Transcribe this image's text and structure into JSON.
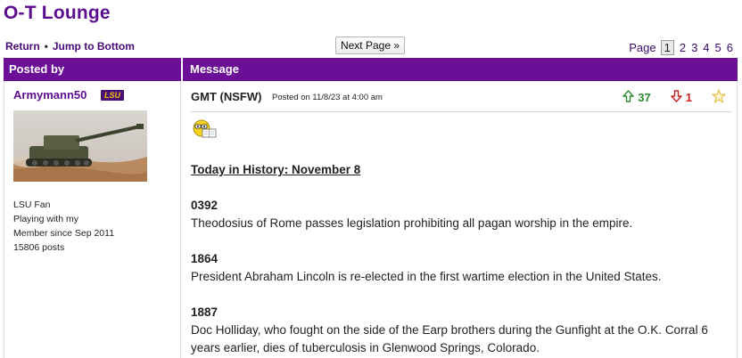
{
  "forum": {
    "title": "O-T Lounge"
  },
  "nav": {
    "return_label": "Return",
    "separator": "•",
    "jump_label": "Jump to Bottom",
    "next_page_label": "Next Page »",
    "page_label": "Page",
    "pages": [
      "1",
      "2",
      "3",
      "4",
      "5",
      "6"
    ],
    "current_page": "1"
  },
  "table": {
    "col_posted_by": "Posted by",
    "col_message": "Message"
  },
  "author": {
    "username": "Armymann50",
    "badge": "LSU",
    "avatar_icon": "artillery-tank-avatar",
    "info": [
      "LSU Fan",
      "Playing with my",
      "Member since Sep 2011",
      "15806 posts"
    ]
  },
  "post": {
    "title": "GMT (NSFW)",
    "posted_on": "Posted on 11/8/23 at 4:00 am",
    "upvotes": "37",
    "downvotes": "1",
    "emoji_icon": "reading-smiley-icon",
    "heading": "Today in History: November 8",
    "events": [
      {
        "year": "0392",
        "text": "Theodosius of Rome passes legislation prohibiting all pagan worship in the empire."
      },
      {
        "year": "1864",
        "text": "President Abraham Lincoln is re-elected in the first wartime election in the United States."
      },
      {
        "year": "1887",
        "text": "Doc Holliday, who fought on the side of the Earp brothers during the Gunfight at the O.K. Corral 6 years earlier, dies of tuberculosis in Glenwood Springs, Colorado."
      }
    ]
  },
  "colors": {
    "purple": "#6a0f96",
    "gold": "#f5c400",
    "up": "#2f8a2f",
    "down": "#c62020"
  }
}
